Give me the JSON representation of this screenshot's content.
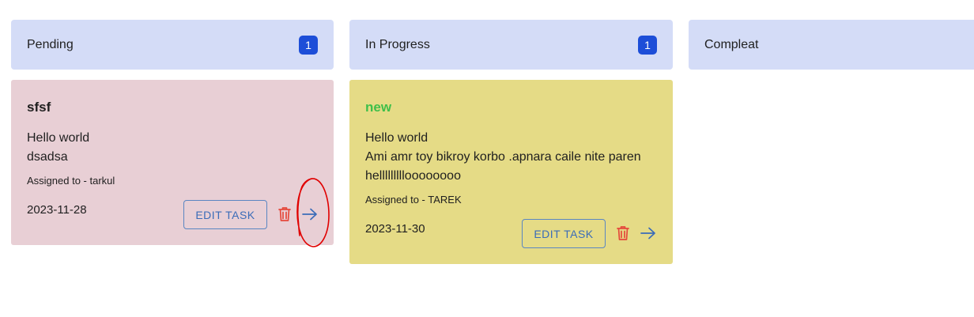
{
  "columns": [
    {
      "title": "Pending",
      "count": "1"
    },
    {
      "title": "In Progress",
      "count": "1"
    },
    {
      "title": "Compleat"
    }
  ],
  "cards": [
    {
      "title": "sfsf",
      "description_lines": [
        "Hello world",
        "dsadsa"
      ],
      "assigned": "Assigned to - tarkul",
      "date": "2023-11-28",
      "edit_label": "EDIT TASK",
      "bg_color": "#e8cfd5",
      "title_color": "#1f1f1f"
    },
    {
      "title": "new",
      "description_lines": [
        "Hello world",
        "Ami amr toy bikroy korbo .apnara caile nite paren",
        "hellllllllloooooooo"
      ],
      "assigned": "Assigned to - TAREK",
      "date": "2023-11-30",
      "edit_label": "EDIT TASK",
      "bg_color": "#e5db86",
      "title_color": "#3fbf4a"
    }
  ],
  "icons": {
    "delete": "trash-icon",
    "move": "arrow-right-icon"
  },
  "colors": {
    "header_bg": "#d4dcf7",
    "badge_bg": "#1d4ed8",
    "delete_icon": "#e5483b",
    "move_icon": "#3b6cb8",
    "annotation": "#e00000"
  }
}
